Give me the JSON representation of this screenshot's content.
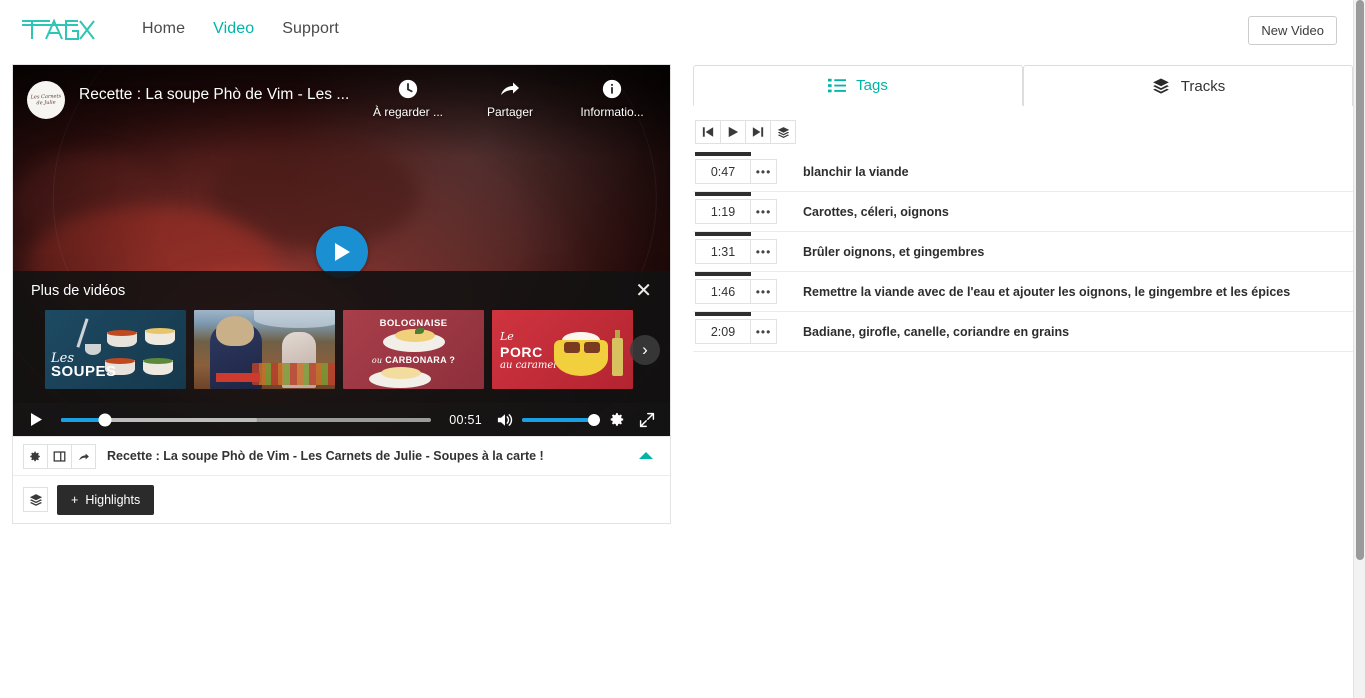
{
  "brand": {
    "logo_text": "TAGX",
    "accent_color": "#00b5a8"
  },
  "nav": {
    "items": [
      {
        "label": "Home",
        "active": false
      },
      {
        "label": "Video",
        "active": true
      },
      {
        "label": "Support",
        "active": false
      }
    ],
    "new_video_label": "New Video"
  },
  "player": {
    "overlay_title": "Recette : La soupe Phò de Vim - Les ...",
    "avatar_text": "Les Carnets de Julie",
    "actions": [
      {
        "icon": "clock-icon",
        "label": "À regarder ..."
      },
      {
        "icon": "share-icon",
        "label": "Partager"
      },
      {
        "icon": "info-icon",
        "label": "Informatio..."
      }
    ],
    "more_videos": {
      "title": "Plus de vidéos",
      "close_label": "✕",
      "next_label": "›",
      "thumbnails": [
        {
          "name": "les-soupes",
          "line1": "Les",
          "line2": "SOUPES"
        },
        {
          "name": "market-scene",
          "line1": "",
          "line2": ""
        },
        {
          "name": "bolognaise-carbonara",
          "line1": "BOLOGNAISE",
          "line2": "CARBONARA ?",
          "line2_prefix": "ou"
        },
        {
          "name": "porc-au-caramel",
          "line1": "Le",
          "line2": "PORC",
          "line3": "au caramel"
        }
      ]
    },
    "controls": {
      "play_label": "play",
      "current_time": "00:51",
      "progress_percent": 12,
      "buffered_percent": 53,
      "volume_percent": 100,
      "mute_label": "mute",
      "settings_label": "settings",
      "fullscreen_label": "fullscreen"
    }
  },
  "video_info": {
    "title": "Recette : La soupe Phò de Vim - Les Carnets de Julie - Soupes à la carte !",
    "buttons": [
      {
        "name": "settings-button",
        "icon": "gear-icon"
      },
      {
        "name": "layout-button",
        "icon": "panel-icon"
      },
      {
        "name": "share-button",
        "icon": "share-icon"
      }
    ],
    "collapse_icon": "caret-up-icon",
    "tracks_icon": "layers-icon",
    "highlights_label": "Highlights",
    "highlights_plus": "+"
  },
  "right_panel": {
    "tabs": [
      {
        "label": "Tags",
        "icon": "list-icon",
        "active": true
      },
      {
        "label": "Tracks",
        "icon": "layers-icon",
        "active": false
      }
    ],
    "toolbar": [
      {
        "name": "skip-previous-button",
        "icon": "skip-previous-icon"
      },
      {
        "name": "play-button",
        "icon": "play-icon"
      },
      {
        "name": "skip-next-button",
        "icon": "skip-next-icon"
      },
      {
        "name": "tracks-button",
        "icon": "layers-icon"
      }
    ],
    "tags": [
      {
        "time": "0:47",
        "menu": "•••",
        "text": "blanchir la viande"
      },
      {
        "time": "1:19",
        "menu": "•••",
        "text": "Carottes, céleri, oignons"
      },
      {
        "time": "1:31",
        "menu": "•••",
        "text": "Brûler oignons, et gingembres"
      },
      {
        "time": "1:46",
        "menu": "•••",
        "text": "Remettre la viande avec de l'eau et ajouter les oignons, le gingembre et les épices"
      },
      {
        "time": "2:09",
        "menu": "•••",
        "text": "Badiane, girofle, canelle, coriandre en grains"
      }
    ]
  }
}
